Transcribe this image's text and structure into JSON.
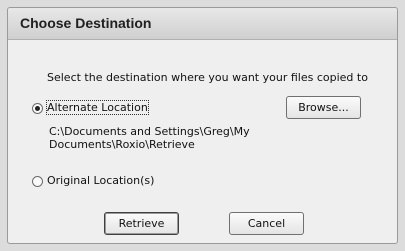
{
  "dialog": {
    "title": "Choose Destination",
    "instruction": "Select the destination where you want your files copied to",
    "options": [
      {
        "label": "Alternate Location",
        "selected": true
      },
      {
        "label": "Original Location(s)",
        "selected": false
      }
    ],
    "path_line1": "C:\\Documents and Settings\\Greg\\My",
    "path_line2": "Documents\\Roxio\\Retrieve",
    "browse_label": "Browse...",
    "retrieve_label": "Retrieve",
    "cancel_label": "Cancel"
  }
}
